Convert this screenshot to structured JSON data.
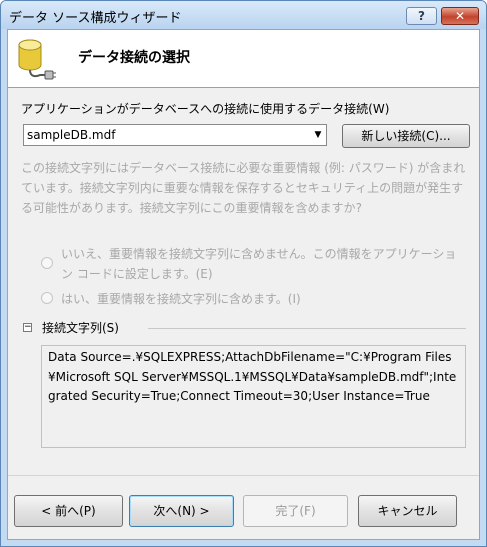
{
  "window": {
    "title": "データ ソース構成ウィザード",
    "help_label": "?",
    "close_label": "✕"
  },
  "header": {
    "title": "データ接続の選択"
  },
  "connection": {
    "question": "アプリケーションがデータベースへの接続に使用するデータ接続(W)",
    "selected": "sampleDB.mdf",
    "new_button": "新しい接続(C)..."
  },
  "sensitive": {
    "description": "この接続文字列にはデータベース接続に必要な重要情報 (例: パスワード) が含まれています。接続文字列内に重要な情報を保存するとセキュリティ上の問題が発生する可能性があります。接続文字列にこの重要情報を含めますか?",
    "option_no": "いいえ、重要情報を接続文字列に含めません。この情報をアプリケーション コードに設定します。(E)",
    "option_yes": "はい、重要情報を接続文字列に含めます。(I)"
  },
  "connection_string": {
    "label": "接続文字列(S)",
    "expander": "−",
    "value": "Data Source=.¥SQLEXPRESS;AttachDbFilename=\"C:¥Program Files¥Microsoft SQL Server¥MSSQL.1¥MSSQL¥Data¥sampleDB.mdf\";Integrated Security=True;Connect Timeout=30;User Instance=True"
  },
  "footer": {
    "prev": "< 前へ(P)",
    "next": "次へ(N) >",
    "finish": "完了(F)",
    "cancel": "キャンセル"
  }
}
